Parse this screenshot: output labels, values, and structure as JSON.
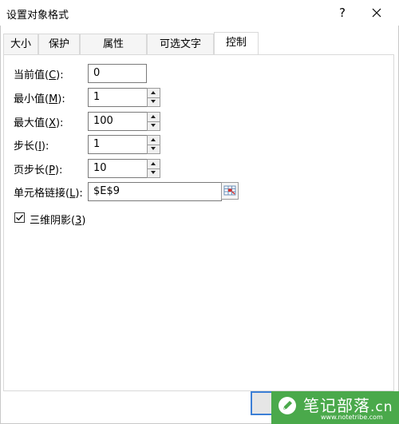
{
  "window": {
    "title": "设置对象格式",
    "help_glyph": "?"
  },
  "tabs": [
    {
      "label": "大小"
    },
    {
      "label": "保护"
    },
    {
      "label": "属性"
    },
    {
      "label": "可选文字"
    },
    {
      "label": "控制",
      "active": true
    }
  ],
  "form": {
    "current_value": {
      "label_pre": "当前值(",
      "hotkey": "C",
      "label_post": "):",
      "value": "0"
    },
    "min_value": {
      "label_pre": "最小值(",
      "hotkey": "M",
      "label_post": "):",
      "value": "1"
    },
    "max_value": {
      "label_pre": "最大值(",
      "hotkey": "X",
      "label_post": "):",
      "value": "100"
    },
    "step": {
      "label_pre": "步长(",
      "hotkey": "I",
      "label_post": "):",
      "value": "1"
    },
    "page_step": {
      "label_pre": "页步长(",
      "hotkey": "P",
      "label_post": "):",
      "value": "10"
    },
    "cell_link": {
      "label_pre": "单元格链接(",
      "hotkey": "L",
      "label_post": "):",
      "value": "$E$9"
    },
    "shading_3d": {
      "label_pre": "三维阴影(",
      "hotkey": "3",
      "label_post": ")",
      "checked": true
    }
  },
  "watermark": {
    "brand": "笔记部落",
    "suffix": ".cn",
    "url": "www.notetribe.com",
    "color": "#4aa94b"
  }
}
